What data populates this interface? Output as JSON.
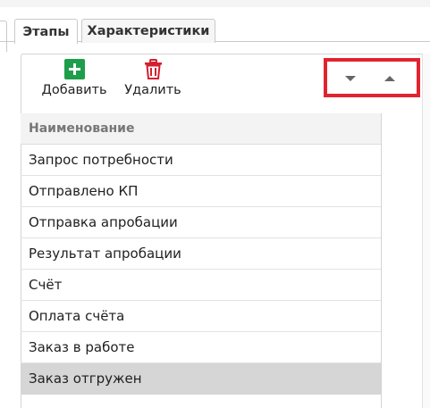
{
  "tabs": [
    {
      "label": "Этапы",
      "active": true
    },
    {
      "label": "Характеристики",
      "active": false
    }
  ],
  "toolbar": {
    "add_label": "Добавить",
    "delete_label": "Удалить",
    "add_icon": "plus-icon",
    "delete_icon": "trash-icon",
    "move_down_icon": "caret-down-icon",
    "move_up_icon": "caret-up-icon"
  },
  "grid": {
    "column_header": "Наименование",
    "rows": [
      "Запрос потребности",
      "Отправлено КП",
      "Отправка апробации",
      "Результат апробации",
      "Счёт",
      "Оплата счёта",
      "Заказ в работе",
      "Заказ отгружен"
    ],
    "selected_index": 7
  },
  "colors": {
    "add_green": "#1e9e4b",
    "delete_red": "#d2202e",
    "highlight_box": "#e0242f",
    "selected_row": "#d6d6d6"
  }
}
